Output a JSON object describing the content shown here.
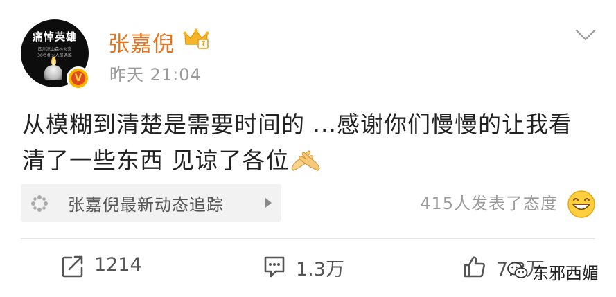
{
  "post": {
    "avatar": {
      "title": "痛悼英雄",
      "subtitle_line1": "四川凉山森林火灾",
      "subtitle_line2": "30名扑火人员遇难"
    },
    "verified_badge": "V",
    "username": "张嘉倪",
    "timestamp": "昨天 21:04",
    "content_line1": "从模糊到清楚是需要时间的 ...感谢你们慢慢的让我看",
    "content_line2": "清了一些东西 见谅了各位",
    "topic_card": {
      "label": "张嘉倪最新动态追踪"
    },
    "reactions_text": "415人发表了态度"
  },
  "actions": {
    "repost_count": "1214",
    "comment_count": "1.3万",
    "like_count": "7.3万"
  },
  "watermark": {
    "text": "东邪西媚"
  },
  "colors": {
    "username": "#e8731c",
    "meta_text": "#9a9a9a",
    "body_text": "#222222",
    "card_bg": "#f2f2f2"
  },
  "icons": [
    "chevron-down-icon",
    "vip-crown-icon",
    "verified-badge-icon",
    "topic-icon",
    "hands-emoji-icon",
    "grin-emoji-icon",
    "repost-icon",
    "comment-icon",
    "like-icon",
    "wechat-icon"
  ]
}
